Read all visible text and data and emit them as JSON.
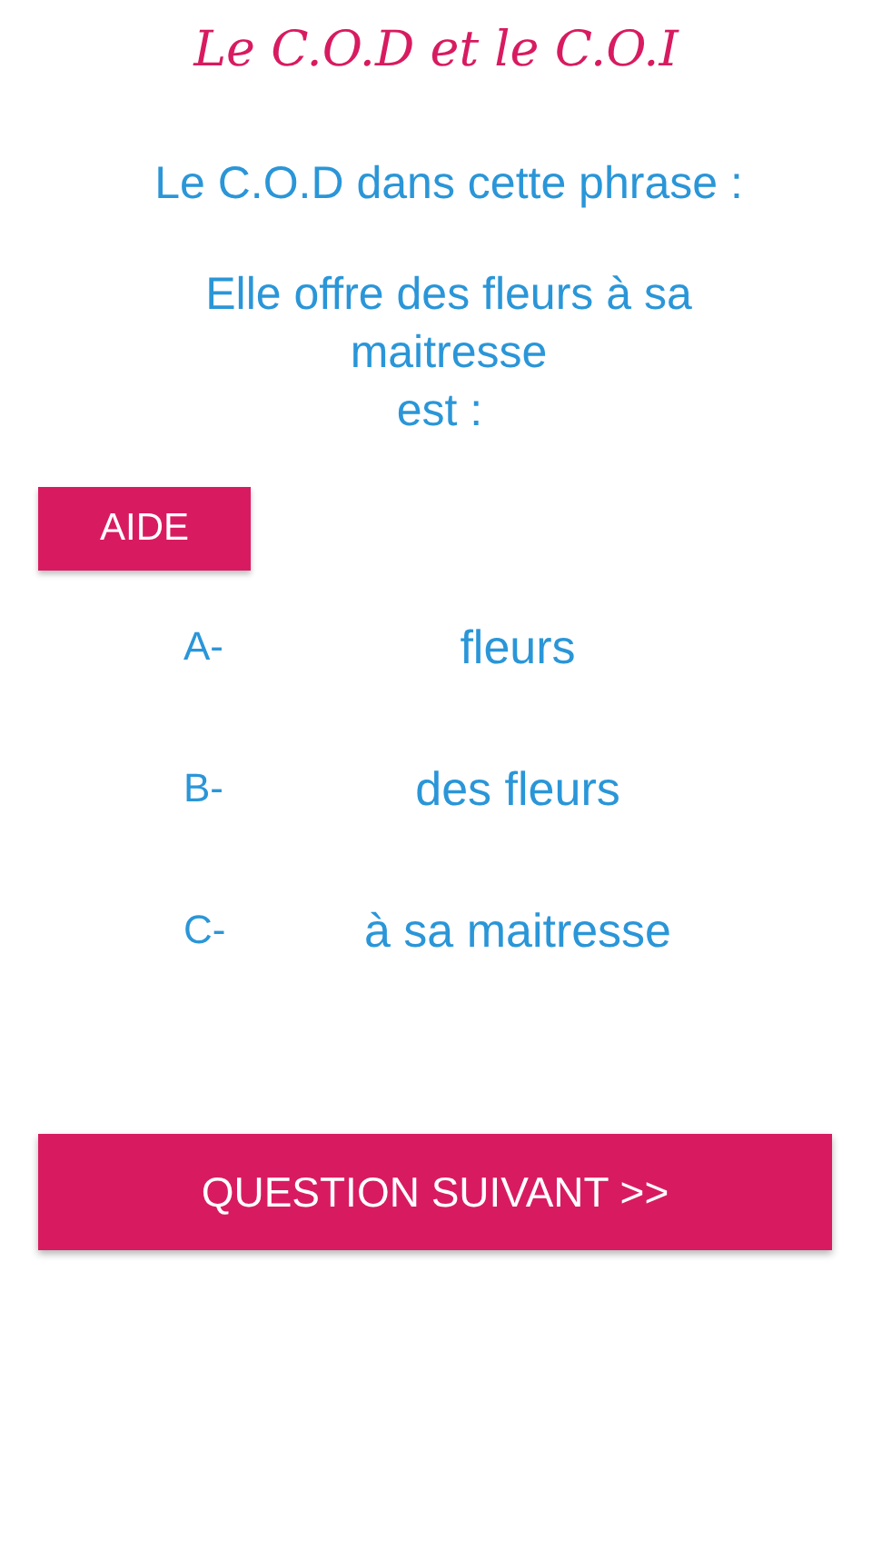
{
  "title": "Le C.O.D et le C.O.I",
  "question": {
    "prompt": "Le C.O.D dans cette phrase :",
    "sentence": "Elle offre des fleurs à sa maitresse",
    "suffix": "est :"
  },
  "help_button": "AIDE",
  "options": [
    {
      "letter": "A-",
      "answer": "fleurs"
    },
    {
      "letter": "B-",
      "answer": "des fleurs"
    },
    {
      "letter": "C-",
      "answer": "à sa maitresse"
    }
  ],
  "next_button": "QUESTION SUIVANT >>"
}
